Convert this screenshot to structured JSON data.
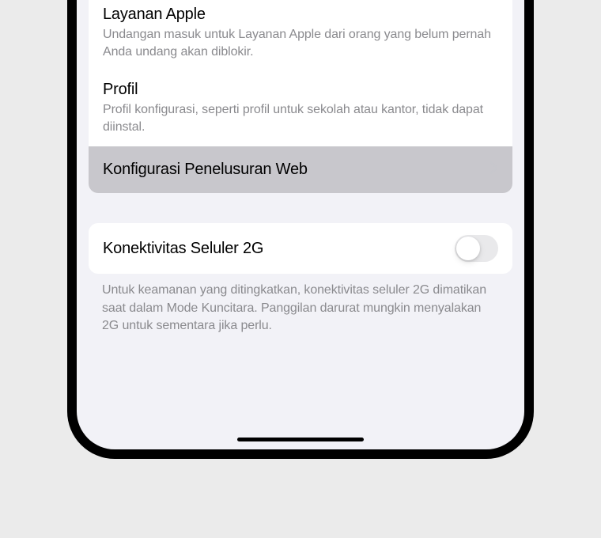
{
  "items": [
    {
      "title": "Layanan Apple",
      "desc": "Undangan masuk untuk Layanan Apple dari orang yang belum pernah Anda undang akan diblokir."
    },
    {
      "title": "Profil",
      "desc": "Profil konfigurasi, seperti profil untuk sekolah atau kantor, tidak dapat diinstal."
    }
  ],
  "navRow": {
    "title": "Konfigurasi Penelusuran Web"
  },
  "toggleRow": {
    "title": "Konektivitas Seluler 2G"
  },
  "footer": "Untuk keamanan yang ditingkatkan, konektivitas seluler 2G dimatikan saat dalam Mode Kuncitara. Panggilan darurat mungkin menyalakan 2G untuk sementara jika perlu."
}
